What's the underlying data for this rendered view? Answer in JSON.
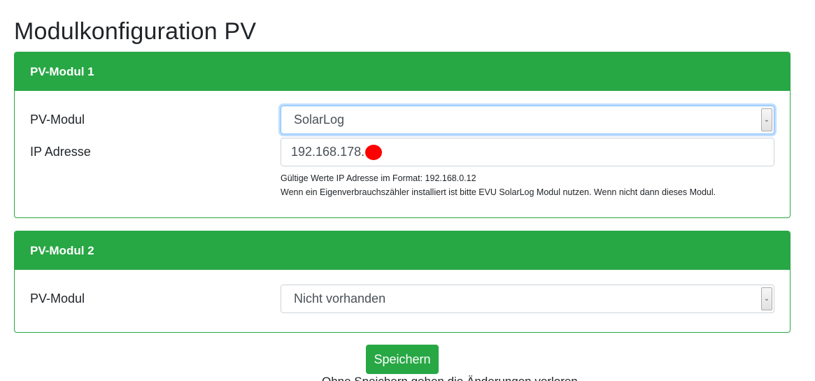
{
  "page": {
    "title": "Modulkonfiguration PV"
  },
  "modules": [
    {
      "header": "PV-Modul 1",
      "pv_modul_label": "PV-Modul",
      "pv_modul_selected": "SolarLog",
      "ip_label": "IP Adresse",
      "ip_value": "192.168.178.",
      "help_line_1": "Gültige Werte IP Adresse im Format: 192.168.0.12",
      "help_line_2": "Wenn ein Eigenverbrauchszähler installiert ist bitte EVU SolarLog Modul nutzen. Wenn nicht dann dieses Modul."
    },
    {
      "header": "PV-Modul 2",
      "pv_modul_label": "PV-Modul",
      "pv_modul_selected": "Nicht vorhanden"
    }
  ],
  "actions": {
    "save_label": "Speichern",
    "footer_note": "Ohne Speichern gehen die Änderungen verloren"
  },
  "colors": {
    "accent": "#28a745",
    "redaction": "#ff0000"
  },
  "icons": {
    "select_arrow": "chevron-down-icon"
  }
}
